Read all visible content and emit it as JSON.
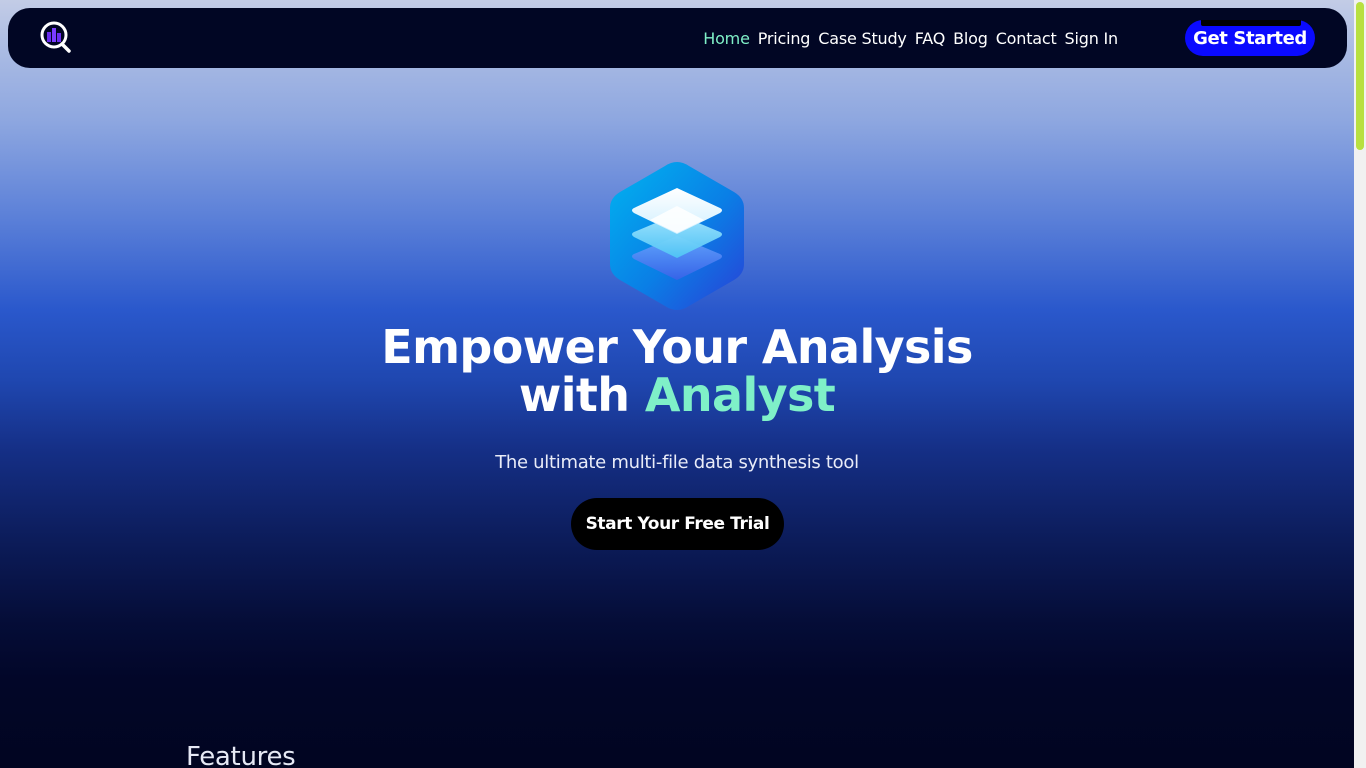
{
  "brand": {
    "logo_icon": "magnifier-bar-chart-icon"
  },
  "nav": {
    "links": [
      {
        "label": "Home",
        "active": true
      },
      {
        "label": "Pricing"
      },
      {
        "label": "Case Study"
      },
      {
        "label": "FAQ"
      },
      {
        "label": "Blog"
      },
      {
        "label": "Contact"
      },
      {
        "label": "Sign In"
      }
    ],
    "cta_label": "Get Started",
    "active_color": "#7ff0c8",
    "cta_color": "#0a0aff"
  },
  "hero": {
    "icon": "hexagon-layers-icon",
    "title_line1": "Empower Your Analysis",
    "title_line2_prefix": "with ",
    "title_accent": "Analyst",
    "subtitle": "The ultimate multi-file data synthesis tool",
    "button_label": "Start Your Free Trial"
  },
  "features": {
    "heading": "Features"
  }
}
